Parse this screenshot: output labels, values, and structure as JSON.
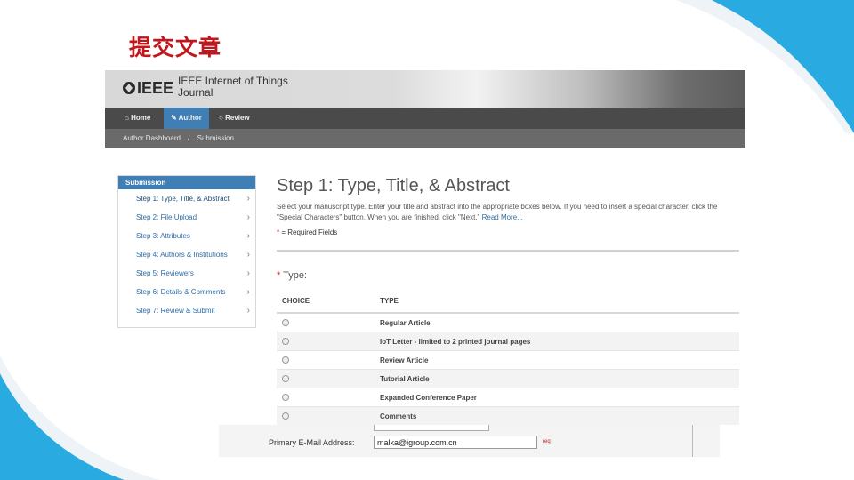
{
  "slide": {
    "title": "提交文章"
  },
  "site": {
    "logo_text": "IEEE",
    "journal_name": "IEEE Internet of Things Journal"
  },
  "nav": {
    "items": [
      {
        "label": "Home",
        "icon": "home-icon"
      },
      {
        "label": "Author",
        "icon": "pencil-icon",
        "active": true
      },
      {
        "label": "Review",
        "icon": "comment-icon"
      }
    ]
  },
  "breadcrumb": {
    "first": "Author Dashboard",
    "separator": "/",
    "current": "Submission"
  },
  "sidebar": {
    "header": "Submission",
    "items": [
      {
        "label": "Step 1: Type, Title, & Abstract",
        "active": true
      },
      {
        "label": "Step 2: File Upload"
      },
      {
        "label": "Step 3: Attributes"
      },
      {
        "label": "Step 4: Authors & Institutions"
      },
      {
        "label": "Step 5: Reviewers"
      },
      {
        "label": "Step 6: Details & Comments"
      },
      {
        "label": "Step 7: Review & Submit"
      }
    ]
  },
  "main": {
    "heading": "Step 1: Type, Title, & Abstract",
    "intro_line1": "Select your manuscript type. Enter your title and abstract into the appropriate boxes below. If you need to insert a special character, click the",
    "intro_line2": "\"Special Characters\" button. When you are finished, click \"Next.\"",
    "read_more": "Read More...",
    "required_note": "= Required Fields",
    "type_label": "Type:",
    "table": {
      "headers": [
        "CHOICE",
        "TYPE"
      ],
      "rows": [
        "Regular Article",
        "IoT Letter - limited to 2 printed journal pages",
        "Review Article",
        "Tutorial Article",
        "Expanded Conference Paper",
        "Comments"
      ]
    }
  },
  "lower_form": {
    "email_label": "Primary E-Mail Address:",
    "email_value": "malka@igroup.com.cn",
    "req_marker": "req"
  },
  "colors": {
    "title_red": "#c0161c",
    "accent_blue": "#3f7fb6",
    "deco_blue": "#29abe2"
  }
}
